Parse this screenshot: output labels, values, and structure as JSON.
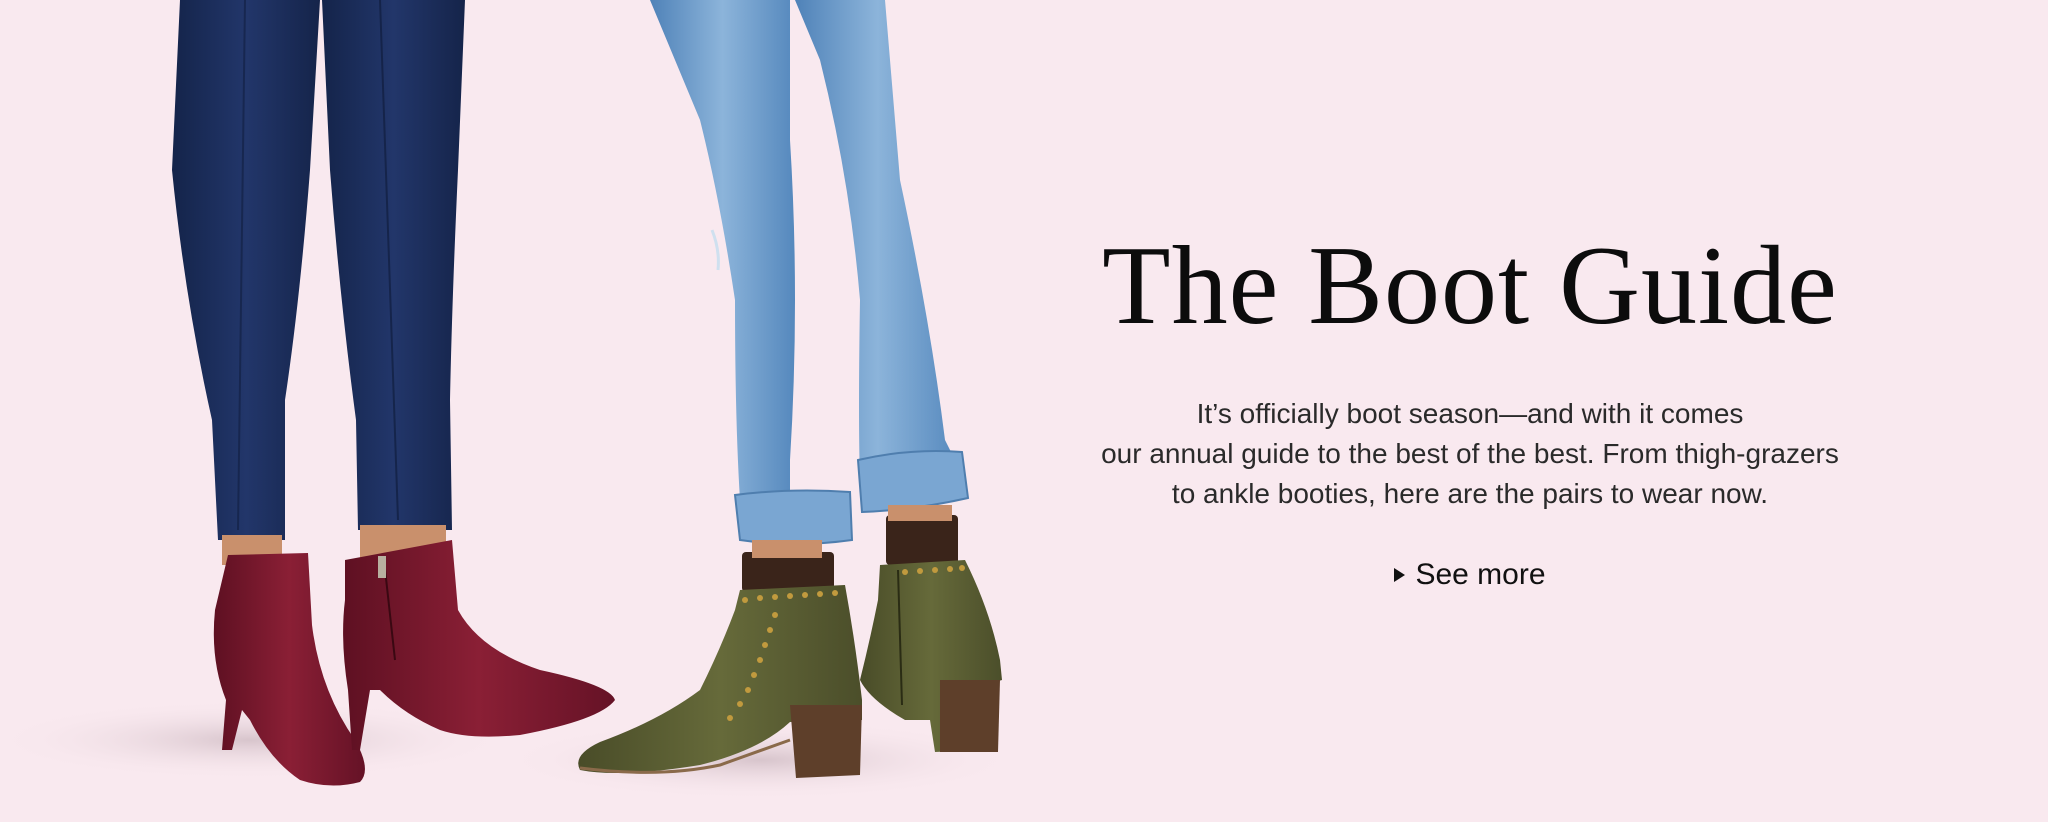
{
  "hero": {
    "title": "The Boot Guide",
    "body_lines": [
      "It’s officially boot season—and with it comes",
      "our annual guide to the best of the best. From thigh-grazers",
      "to ankle booties, here are the pairs to wear now."
    ],
    "cta_label": "See more",
    "cta_icon": "play-triangle-icon"
  },
  "colors": {
    "background": "#f9e9ef",
    "dark_denim": "#1e2f58",
    "light_denim": "#6f9dcb",
    "burgundy_suede": "#7a1a2e",
    "olive_suede": "#5a5e33",
    "heel_wood": "#6b4a33",
    "text": "#111111"
  }
}
